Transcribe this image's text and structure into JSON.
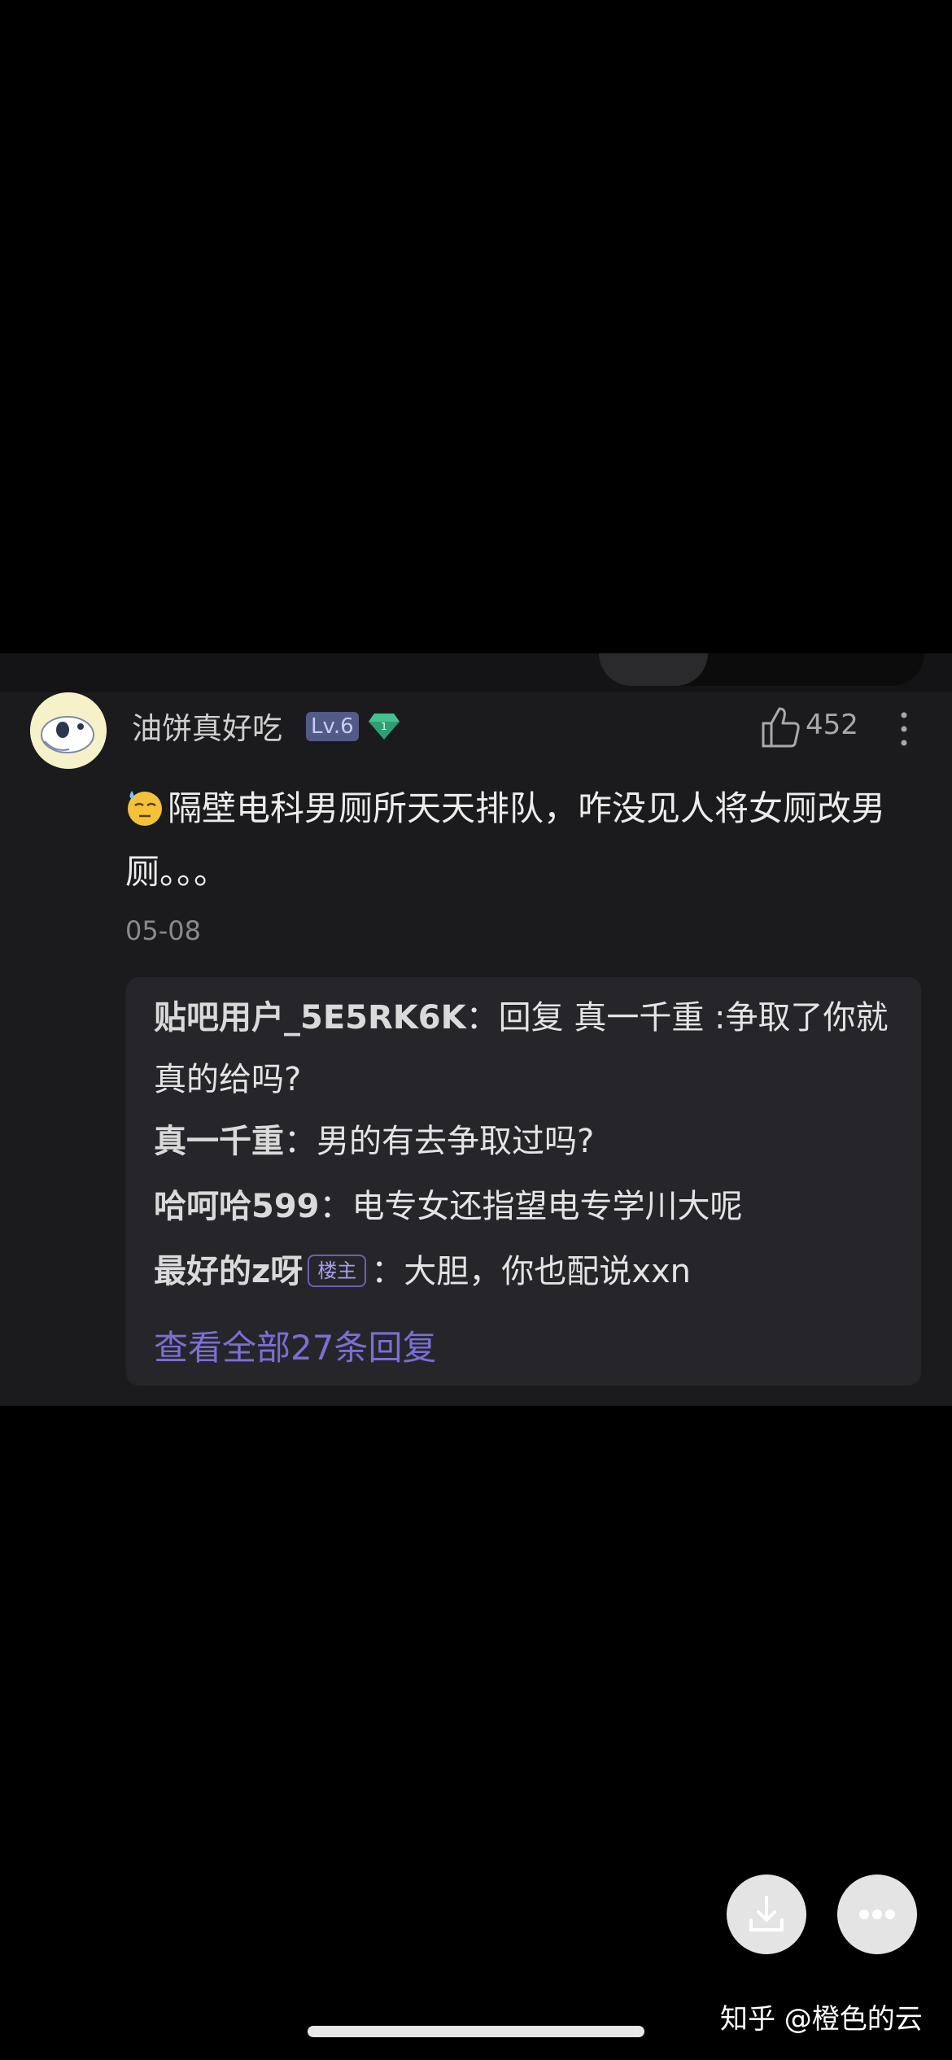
{
  "comment": {
    "username": "油饼真好吃",
    "level": "Lv.6",
    "level_badge_number": "1",
    "like_count": "452",
    "content": "隔壁电科男厕所天天排队，咋没见人将女厕改男厕。。。",
    "date": "05-08"
  },
  "replies": [
    {
      "name": "贴吧用户_5E5RK6K",
      "text": "回复 真一千重 :争取了你就真的给吗?",
      "owner": false
    },
    {
      "name": "真一千重",
      "text": "男的有去争取过吗?",
      "owner": false
    },
    {
      "name": "哈呵哈599",
      "text": "电专女还指望电专学川大呢",
      "owner": false
    },
    {
      "name": "最好的z呀",
      "text": "大胆，你也配说xxn",
      "owner": true
    }
  ],
  "owner_tag": "楼主",
  "view_all_label": "查看全部27条回复",
  "watermark": "知乎 @橙色的云",
  "icons": {
    "download": "download-icon",
    "more": "more-dots-icon",
    "like": "thumbs-up-icon",
    "gem": "diamond-badge-icon"
  },
  "colors": {
    "background": "#000000",
    "card": "#1b1b1d",
    "reply_box": "#26262a",
    "accent_link": "#7b6fd6",
    "level_badge": "#525a88",
    "gem": "#2e9e74"
  }
}
